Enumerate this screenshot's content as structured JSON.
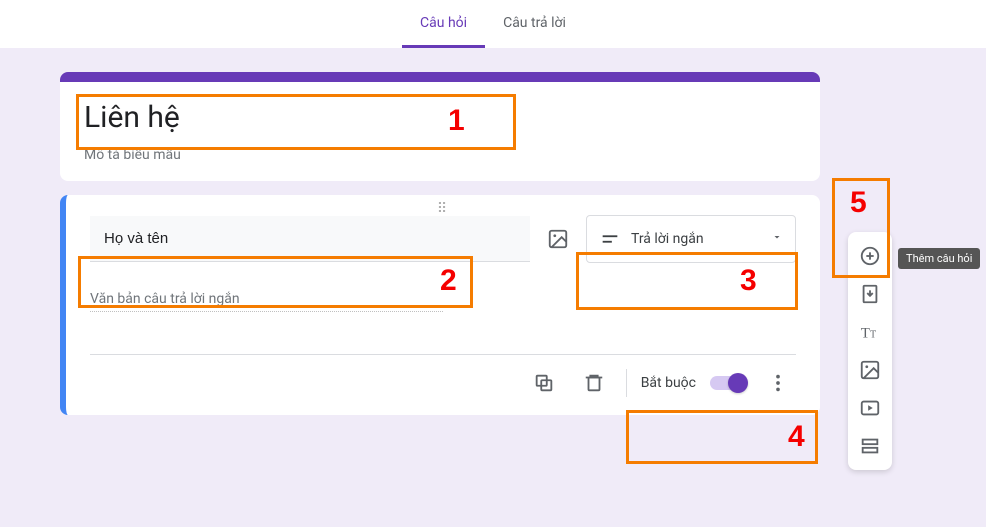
{
  "tabs": {
    "questions": "Câu hỏi",
    "responses": "Câu trả lời"
  },
  "header": {
    "title": "Liên hệ",
    "description": "Mô tả biểu mẫu"
  },
  "question": {
    "title": "Họ và tên",
    "answer_placeholder": "Văn bản câu trả lời ngắn",
    "type_label": "Trả lời ngắn",
    "required_label": "Bắt buộc"
  },
  "tooltip": {
    "add_question": "Thêm câu hỏi"
  },
  "annotations": {
    "n1": "1",
    "n2": "2",
    "n3": "3",
    "n4": "4",
    "n5": "5"
  }
}
